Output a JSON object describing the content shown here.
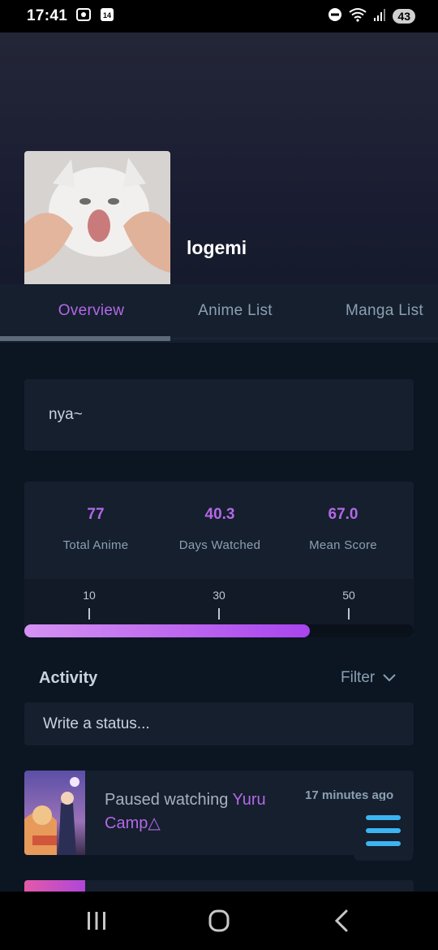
{
  "status_bar": {
    "time": "17:41",
    "notification_count": "14",
    "battery": "43"
  },
  "profile": {
    "username": "logemi"
  },
  "tabs": [
    {
      "label": "Overview",
      "active": true
    },
    {
      "label": "Anime List",
      "active": false
    },
    {
      "label": "Manga List",
      "active": false
    }
  ],
  "bio": "nya~",
  "stats": [
    {
      "value": "77",
      "label": "Total Anime"
    },
    {
      "value": "40.3",
      "label": "Days Watched"
    },
    {
      "value": "67.0",
      "label": "Mean Score"
    }
  ],
  "progress": {
    "ticks": [
      "10",
      "30",
      "50"
    ],
    "value": 40.3,
    "scale_min": 0,
    "scale_max": 60
  },
  "activity": {
    "title": "Activity",
    "filter_label": "Filter",
    "status_placeholder": "Write a status...",
    "items": [
      {
        "action": "Paused watching ",
        "media": "Yuru Camp△",
        "time": "17 minutes ago"
      }
    ]
  },
  "colors": {
    "accent": "#b368e6",
    "fab_icon": "#3db4f2",
    "background": "#0b1622",
    "card": "#151f2e"
  },
  "icons": {
    "menu": "hamburger-menu-icon",
    "filter": "chevron-down-icon",
    "nav_recents": "recents-icon",
    "nav_home": "home-icon",
    "nav_back": "back-icon"
  }
}
